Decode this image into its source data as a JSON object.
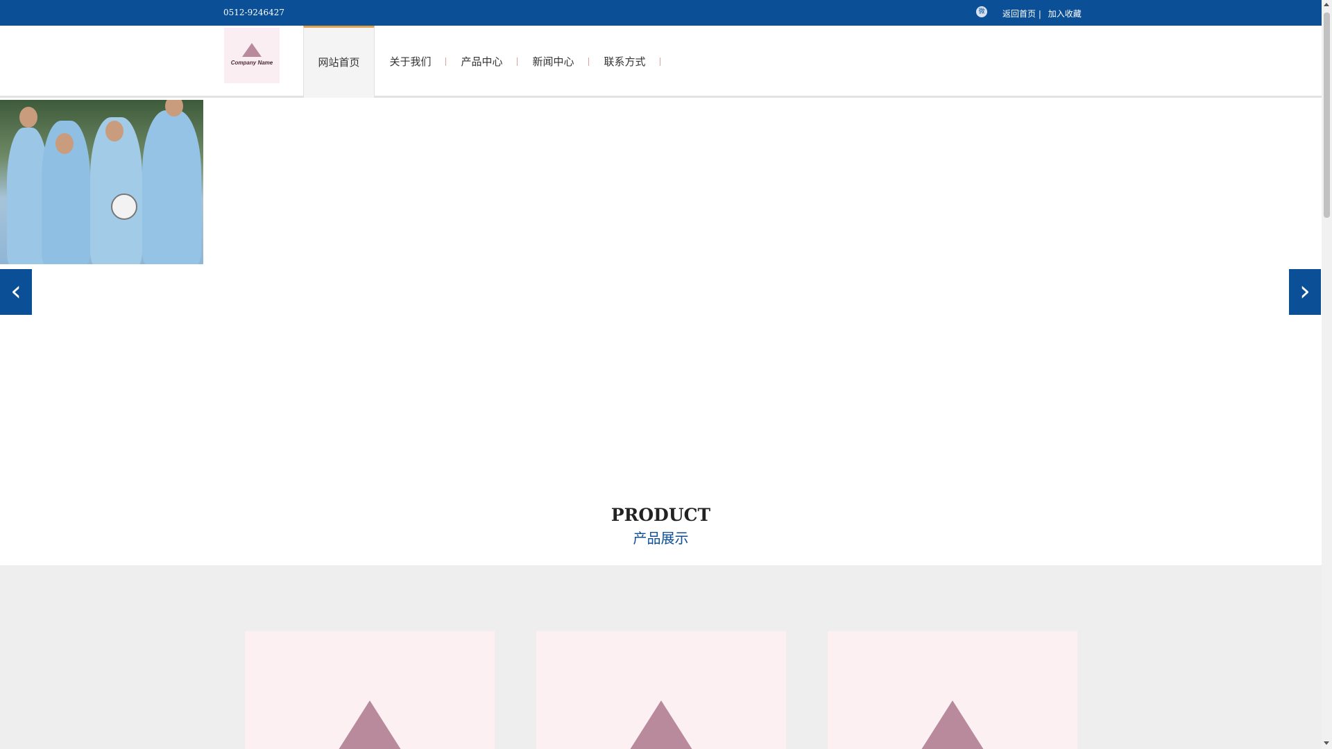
{
  "topbar": {
    "phone": "0512-9246427",
    "wechat_icon": "wechat-icon",
    "links": [
      "返回首页 |",
      "加入收藏"
    ]
  },
  "logo": {
    "text": "Company Name"
  },
  "nav": {
    "items": [
      "网站首页",
      "关于我们",
      "产品中心",
      "新闻中心",
      "联系方式"
    ],
    "active": 0
  },
  "banner": {
    "prev_arrow": "‹",
    "next_arrow": "›"
  },
  "product_section": {
    "title": "PRODUCT",
    "subtitle": "产品展示"
  },
  "colors": {
    "brand_blue": "#0b4f97",
    "nav_accent": "#e1a34a",
    "placeholder_pink": "#fcf0f3",
    "placeholder_mauve": "#b88a9c"
  }
}
